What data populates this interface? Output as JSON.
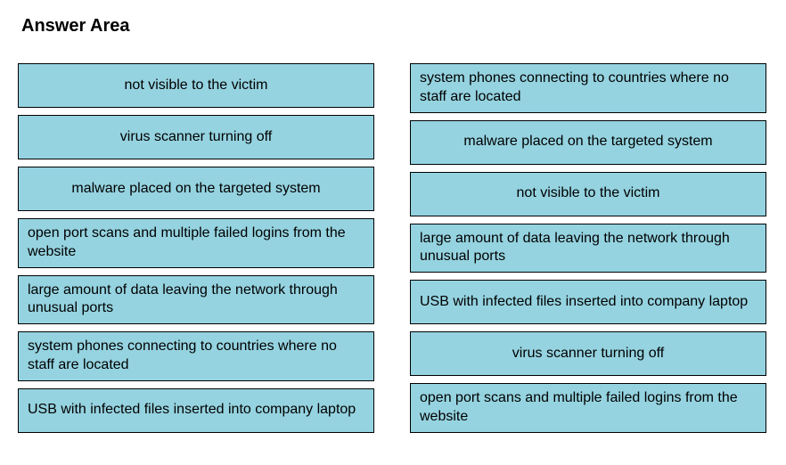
{
  "title": "Answer Area",
  "left_column": [
    {
      "text": "not visible to the victim",
      "align": "center"
    },
    {
      "text": "virus scanner turning off",
      "align": "center"
    },
    {
      "text": "malware placed on the targeted system",
      "align": "center"
    },
    {
      "text": "open port scans and multiple failed logins from the website",
      "align": "left"
    },
    {
      "text": "large amount of data leaving the network through unusual ports",
      "align": "left"
    },
    {
      "text": "system phones connecting to countries where no staff are located",
      "align": "left"
    },
    {
      "text": "USB with infected files inserted into company laptop",
      "align": "left"
    }
  ],
  "right_column": [
    {
      "text": "system phones connecting to countries where no staff are located",
      "align": "left"
    },
    {
      "text": "malware placed on the targeted system",
      "align": "center"
    },
    {
      "text": "not visible to the victim",
      "align": "center"
    },
    {
      "text": "large amount of data leaving the network through unusual ports",
      "align": "left"
    },
    {
      "text": "USB with infected files inserted into company laptop",
      "align": "left"
    },
    {
      "text": "virus scanner turning off",
      "align": "center"
    },
    {
      "text": "open port scans and multiple failed logins from the website",
      "align": "left"
    }
  ]
}
